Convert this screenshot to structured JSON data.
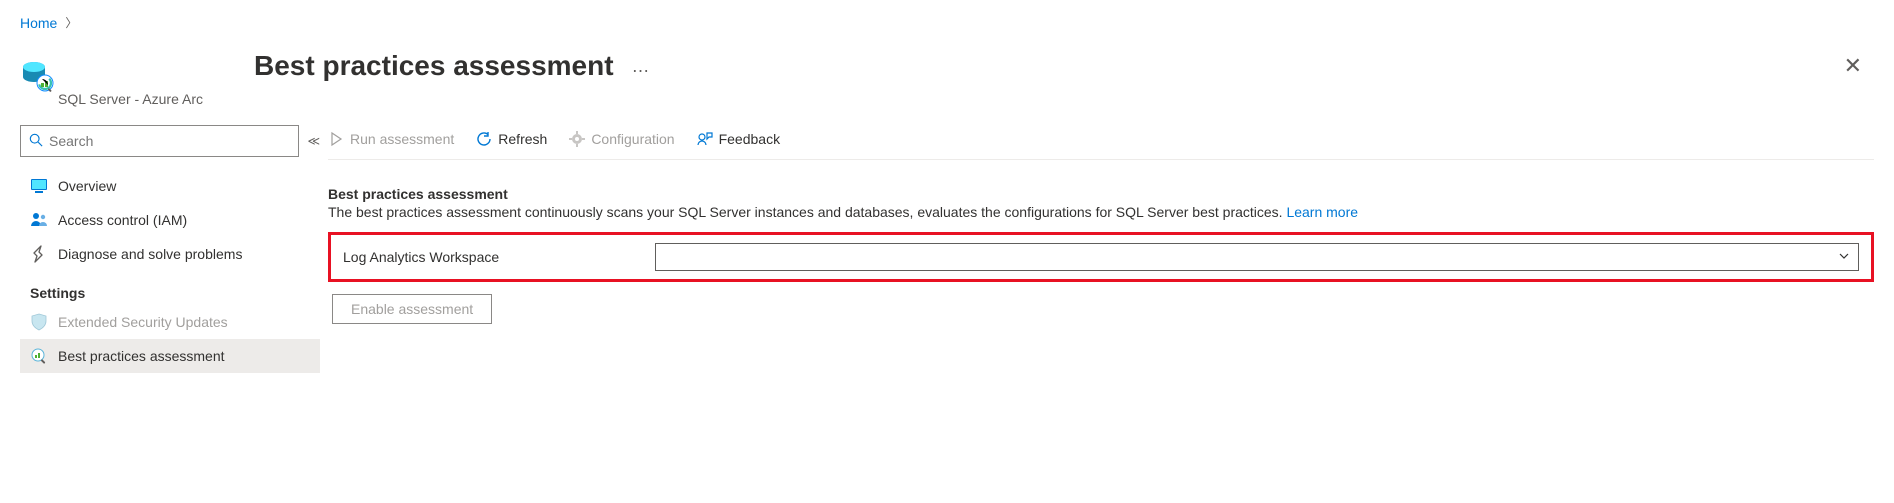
{
  "breadcrumb": {
    "home": "Home"
  },
  "page": {
    "title": "Best practices assessment",
    "subtitle": "SQL Server - Azure Arc"
  },
  "sidebar": {
    "search_placeholder": "Search",
    "items": {
      "overview": "Overview",
      "access_control": "Access control (IAM)",
      "diagnose": "Diagnose and solve problems"
    },
    "settings_heading": "Settings",
    "settings": {
      "extended_security": "Extended Security Updates",
      "best_practices": "Best practices assessment"
    }
  },
  "toolbar": {
    "run": "Run assessment",
    "refresh": "Refresh",
    "configuration": "Configuration",
    "feedback": "Feedback"
  },
  "content": {
    "section_title": "Best practices assessment",
    "section_desc": "The best practices assessment continuously scans your SQL Server instances and databases, evaluates the configurations for SQL Server best practices. ",
    "learn_more": "Learn more",
    "field_label": "Log Analytics Workspace",
    "dropdown_value": "",
    "enable_button": "Enable assessment"
  }
}
